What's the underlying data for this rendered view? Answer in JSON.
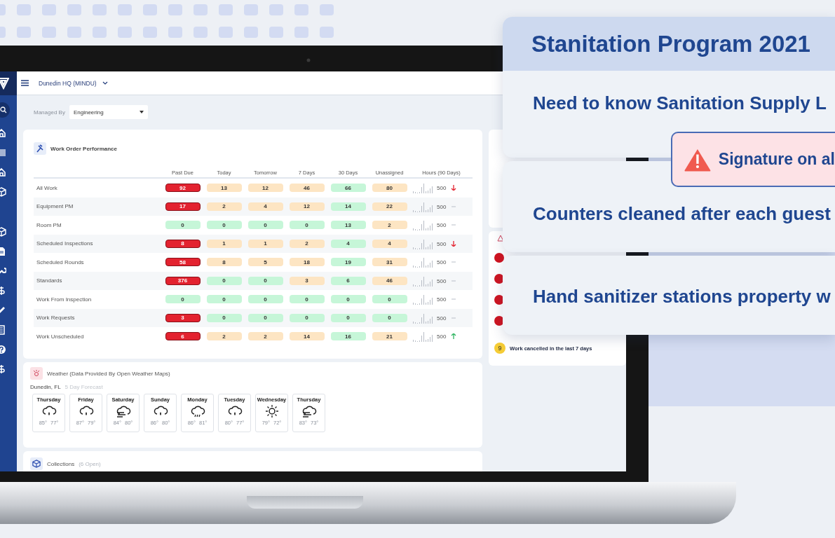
{
  "dashboard": {
    "location": "Dunedin HQ (MINDU)",
    "filter": {
      "label": "Managed By",
      "value": "Engineering"
    },
    "work_order_performance": {
      "title": "Work Order Performance",
      "columns": [
        "Past Due",
        "Today",
        "Tomorrow",
        "7 Days",
        "30 Days",
        "Unassigned",
        "Hours (90 Days)"
      ],
      "rows": [
        {
          "label": "All Work",
          "cells": [
            {
              "value": "92",
              "color": "#e3222f"
            },
            {
              "value": "13",
              "color": "#fde5c3"
            },
            {
              "value": "12",
              "color": "#fde5c3"
            },
            {
              "value": "46",
              "color": "#fde5c3"
            },
            {
              "value": "66",
              "color": "#c6f6d8"
            },
            {
              "value": "80",
              "color": "#fde5c3"
            }
          ],
          "hours": "500",
          "kind": "down"
        },
        {
          "label": "Equipment PM",
          "cells": [
            {
              "value": "17",
              "color": "#e3222f"
            },
            {
              "value": "2",
              "color": "#fde5c3"
            },
            {
              "value": "4",
              "color": "#fde5c3"
            },
            {
              "value": "12",
              "color": "#fde5c3"
            },
            {
              "value": "14",
              "color": "#c6f6d8"
            },
            {
              "value": "22",
              "color": "#fde5c3"
            }
          ],
          "hours": "500",
          "kind": "flat"
        },
        {
          "label": "Room PM",
          "cells": [
            {
              "value": "0",
              "color": "#c6f6d8"
            },
            {
              "value": "0",
              "color": "#c6f6d8"
            },
            {
              "value": "0",
              "color": "#c6f6d8"
            },
            {
              "value": "0",
              "color": "#c6f6d8"
            },
            {
              "value": "13",
              "color": "#c6f6d8"
            },
            {
              "value": "2",
              "color": "#fde5c3"
            }
          ],
          "hours": "500",
          "kind": "flat"
        },
        {
          "label": "Scheduled Inspections",
          "cells": [
            {
              "value": "8",
              "color": "#e3222f"
            },
            {
              "value": "1",
              "color": "#fde5c3"
            },
            {
              "value": "1",
              "color": "#fde5c3"
            },
            {
              "value": "2",
              "color": "#fde5c3"
            },
            {
              "value": "4",
              "color": "#c6f6d8"
            },
            {
              "value": "4",
              "color": "#fde5c3"
            }
          ],
          "hours": "500",
          "kind": "down"
        },
        {
          "label": "Scheduled Rounds",
          "cells": [
            {
              "value": "58",
              "color": "#e3222f"
            },
            {
              "value": "8",
              "color": "#fde5c3"
            },
            {
              "value": "5",
              "color": "#fde5c3"
            },
            {
              "value": "18",
              "color": "#fde5c3"
            },
            {
              "value": "19",
              "color": "#c6f6d8"
            },
            {
              "value": "31",
              "color": "#fde5c3"
            }
          ],
          "hours": "500",
          "kind": "flat"
        },
        {
          "label": "Standards",
          "cells": [
            {
              "value": "376",
              "color": "#e3222f"
            },
            {
              "value": "0",
              "color": "#c6f6d8"
            },
            {
              "value": "0",
              "color": "#c6f6d8"
            },
            {
              "value": "3",
              "color": "#fde5c3"
            },
            {
              "value": "6",
              "color": "#c6f6d8"
            },
            {
              "value": "46",
              "color": "#fde5c3"
            }
          ],
          "hours": "500",
          "kind": "flat"
        },
        {
          "label": "Work From Inspection",
          "cells": [
            {
              "value": "0",
              "color": "#c6f6d8"
            },
            {
              "value": "0",
              "color": "#c6f6d8"
            },
            {
              "value": "0",
              "color": "#c6f6d8"
            },
            {
              "value": "0",
              "color": "#c6f6d8"
            },
            {
              "value": "0",
              "color": "#c6f6d8"
            },
            {
              "value": "0",
              "color": "#c6f6d8"
            }
          ],
          "hours": "500",
          "kind": "flat"
        },
        {
          "label": "Work Requests",
          "cells": [
            {
              "value": "3",
              "color": "#e3222f"
            },
            {
              "value": "0",
              "color": "#c6f6d8"
            },
            {
              "value": "0",
              "color": "#c6f6d8"
            },
            {
              "value": "0",
              "color": "#c6f6d8"
            },
            {
              "value": "0",
              "color": "#c6f6d8"
            },
            {
              "value": "0",
              "color": "#c6f6d8"
            }
          ],
          "hours": "500",
          "kind": "flat"
        },
        {
          "label": "Work Unscheduled",
          "cells": [
            {
              "value": "6",
              "color": "#e3222f"
            },
            {
              "value": "2",
              "color": "#fde5c3"
            },
            {
              "value": "2",
              "color": "#fde5c3"
            },
            {
              "value": "14",
              "color": "#fde5c3"
            },
            {
              "value": "16",
              "color": "#c6f6d8"
            },
            {
              "value": "21",
              "color": "#fde5c3"
            }
          ],
          "hours": "500",
          "kind": "up"
        }
      ]
    },
    "weather": {
      "title": "Weather (Data Provided By Open Weather Maps)",
      "location": "Dunedin, FL",
      "subtitle": "5 Day Forecast",
      "days": [
        {
          "day": "Thursday",
          "kind": "rain",
          "high": "85°",
          "low": "77°"
        },
        {
          "day": "Friday",
          "kind": "rain",
          "high": "87°",
          "low": "79°"
        },
        {
          "day": "Saturday",
          "kind": "wind",
          "high": "84°",
          "low": "80°"
        },
        {
          "day": "Sunday",
          "kind": "rain",
          "high": "86°",
          "low": "80°"
        },
        {
          "day": "Monday",
          "kind": "showers",
          "high": "86°",
          "low": "81°"
        },
        {
          "day": "Tuesday",
          "kind": "rain",
          "high": "80°",
          "low": "77°"
        },
        {
          "day": "Wednesday",
          "kind": "sun",
          "high": "79°",
          "low": "72°"
        },
        {
          "day": "Thursday",
          "kind": "wind",
          "high": "83°",
          "low": "73°"
        }
      ]
    },
    "collections": {
      "title": "Collections",
      "count": "(6 Open)"
    },
    "side_panel": {
      "alert_badges": [
        {
          "kind": "alert"
        },
        {
          "kind": "alert"
        },
        {
          "kind": "alert"
        },
        {
          "kind": "alert"
        }
      ],
      "cancelled": {
        "count": "9",
        "label": "Work cancelled in the last 7 days"
      }
    }
  },
  "overlay": {
    "title": "Stanitation Program 2021",
    "items": [
      {
        "text": "Need to know Sanitation Supply L"
      },
      {
        "text": "Counters cleaned after each guest"
      },
      {
        "text": "Hand sanitizer stations property w"
      }
    ],
    "alert": "Signature on al"
  }
}
